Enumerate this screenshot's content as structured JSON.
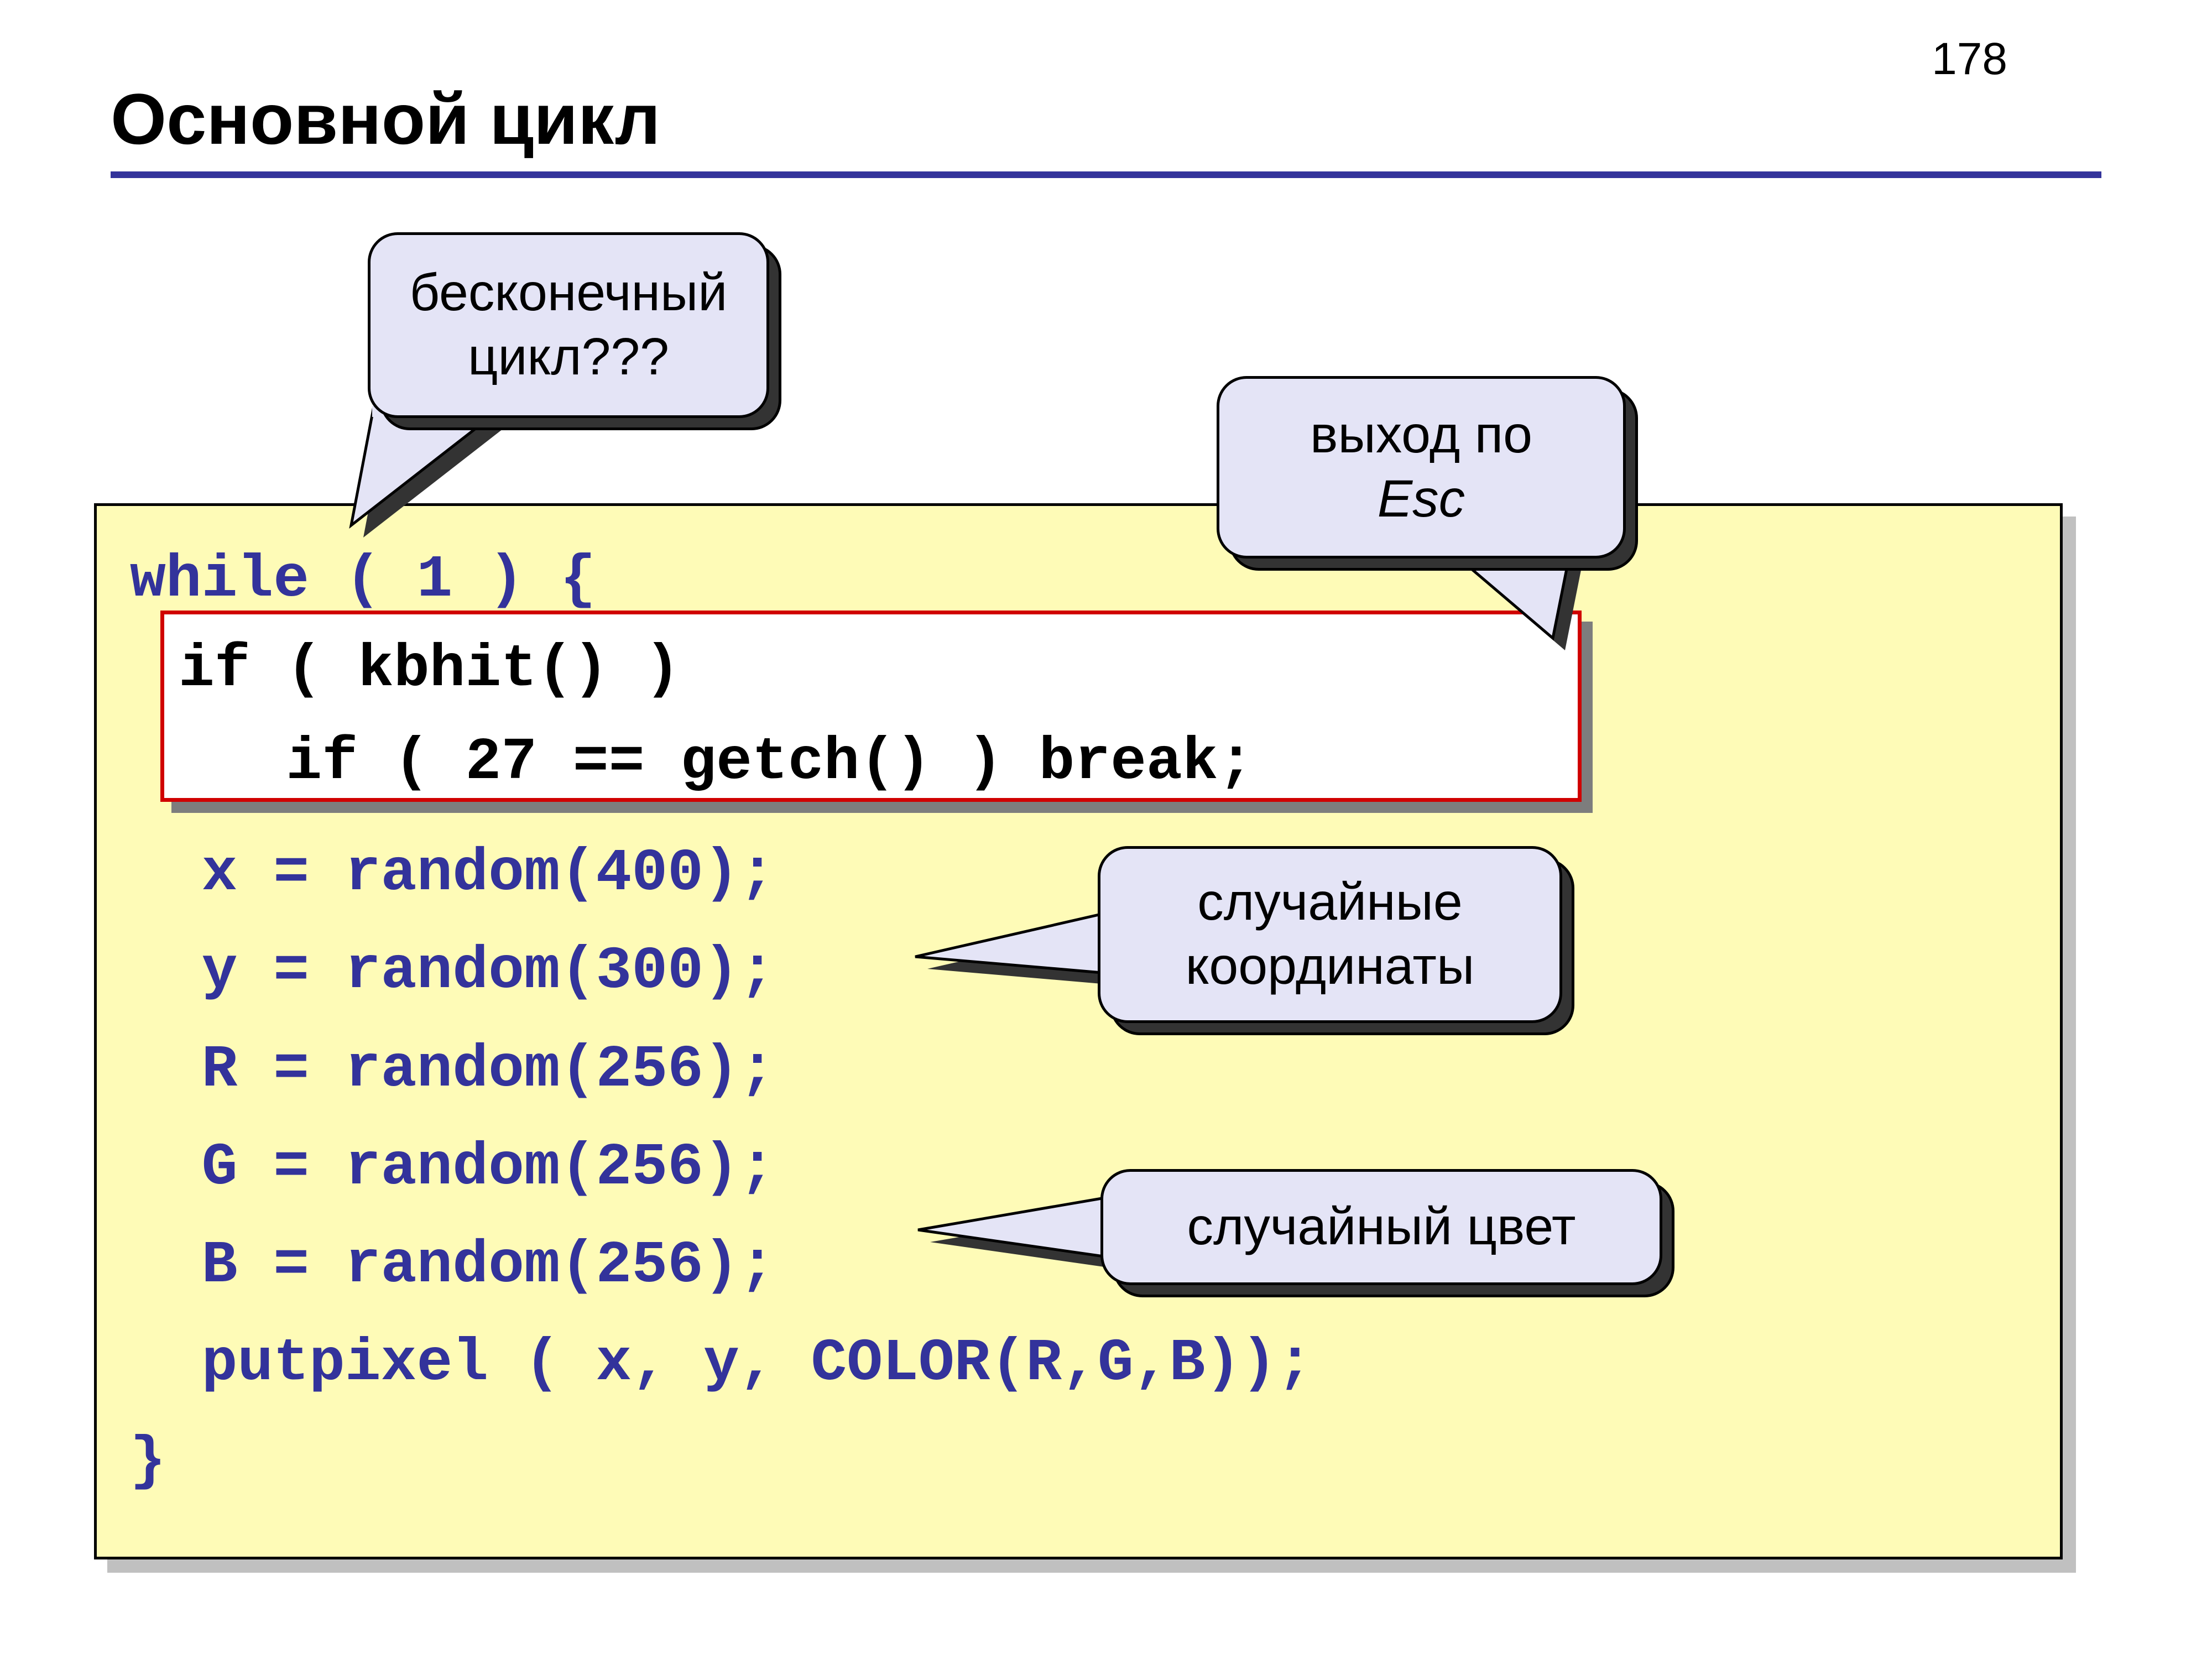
{
  "page_number": "178",
  "title": "Основной цикл",
  "code": {
    "line1": "while ( 1 ) {",
    "indent": "  ",
    "line_x": "  x = random(400);",
    "line_y": "  y = random(300);",
    "line_R": "  R = random(256);",
    "line_G": "  G = random(256);",
    "line_B": "  B = random(256);",
    "line_put": "  putpixel ( x, y, COLOR(R,G,B));",
    "line_close": "}"
  },
  "highlight": {
    "line1": "if ( kbhit() )",
    "line2": "   if ( 27 == getch() ) break;"
  },
  "callouts": {
    "infinite": {
      "line1": "бесконечный",
      "line2": "цикл???"
    },
    "esc": {
      "line1": "выход по",
      "line2_italic": "Esc"
    },
    "coords": {
      "line1": "случайные",
      "line2": "координаты"
    },
    "color": {
      "line1": "случайный цвет"
    }
  }
}
